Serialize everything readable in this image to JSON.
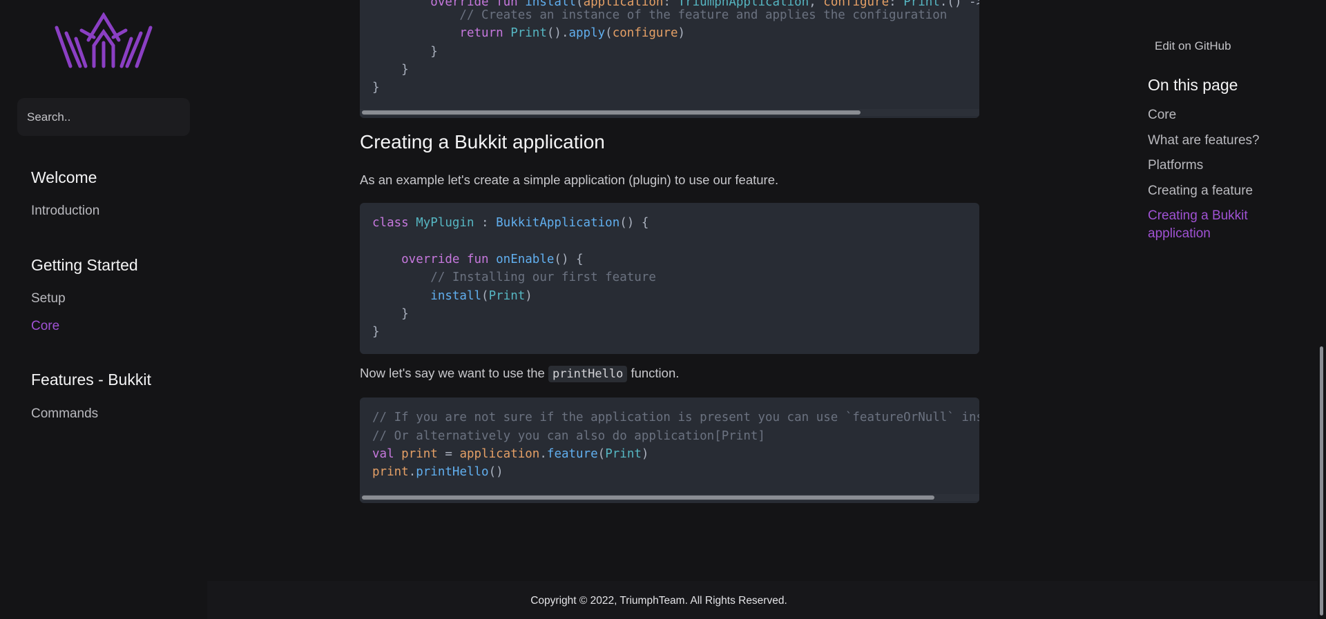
{
  "search": {
    "placeholder": "Search.."
  },
  "sidebar": {
    "sections": [
      {
        "heading": "Welcome",
        "items": [
          "Introduction"
        ]
      },
      {
        "heading": "Getting Started",
        "items": [
          "Setup",
          "Core"
        ]
      },
      {
        "heading": "Features - Bukkit",
        "items": [
          "Commands"
        ]
      }
    ],
    "active_item": "Core"
  },
  "main": {
    "top_code": {
      "lines": [
        "        override fun install(application: TriumphApplication, configure: Print.() -> Unit): Print {",
        "            // Creates an instance of the feature and applies the configuration",
        "            return Print().apply(configure)",
        "        }",
        "    }",
        "}"
      ],
      "scroll_fraction": 0.81
    },
    "heading": "Creating a Bukkit application",
    "intro": "As an example let's create a simple application (plugin) to use our feature.",
    "code_plugin": {
      "lines": [
        "class MyPlugin : BukkitApplication() {",
        "",
        "    override fun onEnable() {",
        "        // Installing our first feature",
        "        install(Print)",
        "    }",
        "}"
      ]
    },
    "para2": {
      "before": "Now let's say we want to use the ",
      "code": "printHello",
      "after": " function."
    },
    "code_usage": {
      "lines": [
        "// If you are not sure if the application is present you can use `featureOrNull` instead",
        "// Or alternatively you can also do application[Print]",
        "val print = application.feature(Print)",
        "print.printHello()"
      ],
      "scroll_fraction": 0.93
    }
  },
  "toc": {
    "edit": "Edit on GitHub",
    "title": "On this page",
    "items": [
      "Core",
      "What are features?",
      "Platforms",
      "Creating a feature",
      "Creating a Bukkit application"
    ],
    "active_item": "Creating a Bukkit application"
  },
  "footer": {
    "copyright": "Copyright © 2022, TriumphTeam. All Rights Reserved."
  },
  "colors": {
    "accent": "#a052d4",
    "background": "#141416",
    "code_bg": "#282c34"
  }
}
